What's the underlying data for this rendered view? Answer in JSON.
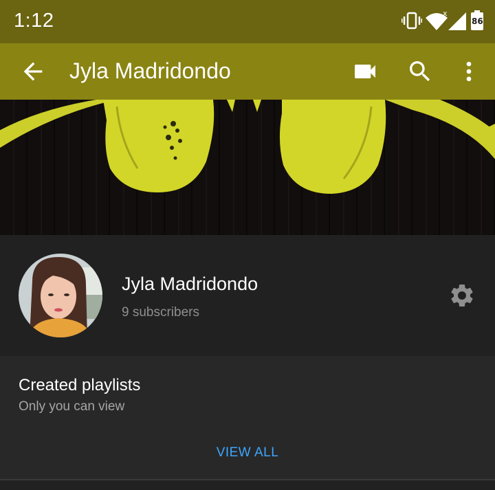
{
  "status_bar": {
    "time": "1:12",
    "battery_level": "86",
    "icons": [
      "vibrate-icon",
      "wifi-icon",
      "cell-signal-icon",
      "battery-icon"
    ]
  },
  "app_bar": {
    "title": "Jyla Madridondo",
    "color": "#8a8413",
    "icons": [
      "back-arrow-icon",
      "video-camera-icon",
      "search-icon",
      "more-vert-icon"
    ]
  },
  "channel": {
    "name": "Jyla Madridondo",
    "subscribers": "9 subscribers",
    "settings_icon": "gear-icon"
  },
  "playlists": {
    "title": "Created playlists",
    "subtitle": "Only you can view",
    "view_all": "VIEW ALL",
    "accent_color": "#3ea6ff"
  }
}
